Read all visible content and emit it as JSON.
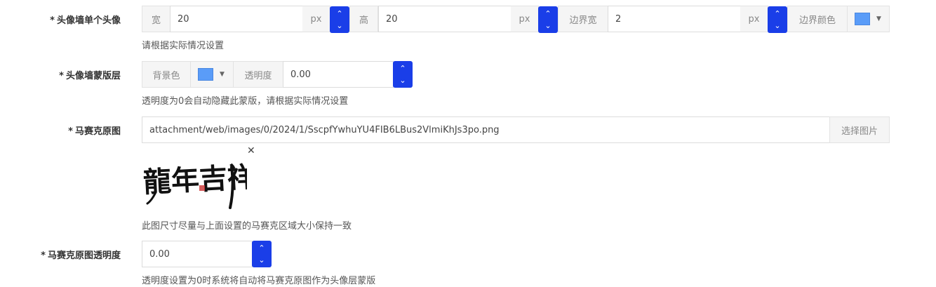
{
  "avatar_wall": {
    "label": "头像墙单个头像",
    "width_addon": "宽",
    "width_value": "20",
    "width_unit": "px",
    "height_addon": "高",
    "height_value": "20",
    "height_unit": "px",
    "border_width_addon": "边界宽",
    "border_width_value": "2",
    "border_width_unit": "px",
    "border_color_addon": "边界颜色",
    "border_color": "#5a9cf8",
    "help": "请根据实际情况设置"
  },
  "mask_layer": {
    "label": "头像墙蒙版层",
    "bg_color_addon": "背景色",
    "bg_color": "#5a9cf8",
    "opacity_addon": "透明度",
    "opacity_value": "0.00",
    "help": "透明度为0会自动隐藏此蒙版，请根据实际情况设置"
  },
  "mosaic_image": {
    "label": "马赛克原图",
    "path": "attachment/web/images/0/2024/1/SscpfYwhuYU4FIB6LBus2VlmiKhJs3po.png",
    "select_button": "选择图片",
    "preview_text": "龍年吉祥",
    "help": "此图尺寸尽量与上面设置的马赛克区域大小保持一致"
  },
  "mosaic_opacity": {
    "label": "马赛克原图透明度",
    "value": "0.00",
    "help": "透明度设置为0时系统将自动将马赛克原图作为头像层蒙版"
  },
  "required_mark": "*",
  "icons": {
    "up": "chevron-up-icon",
    "down": "chevron-down-icon",
    "caret": "caret-down-icon",
    "close": "close-icon"
  }
}
